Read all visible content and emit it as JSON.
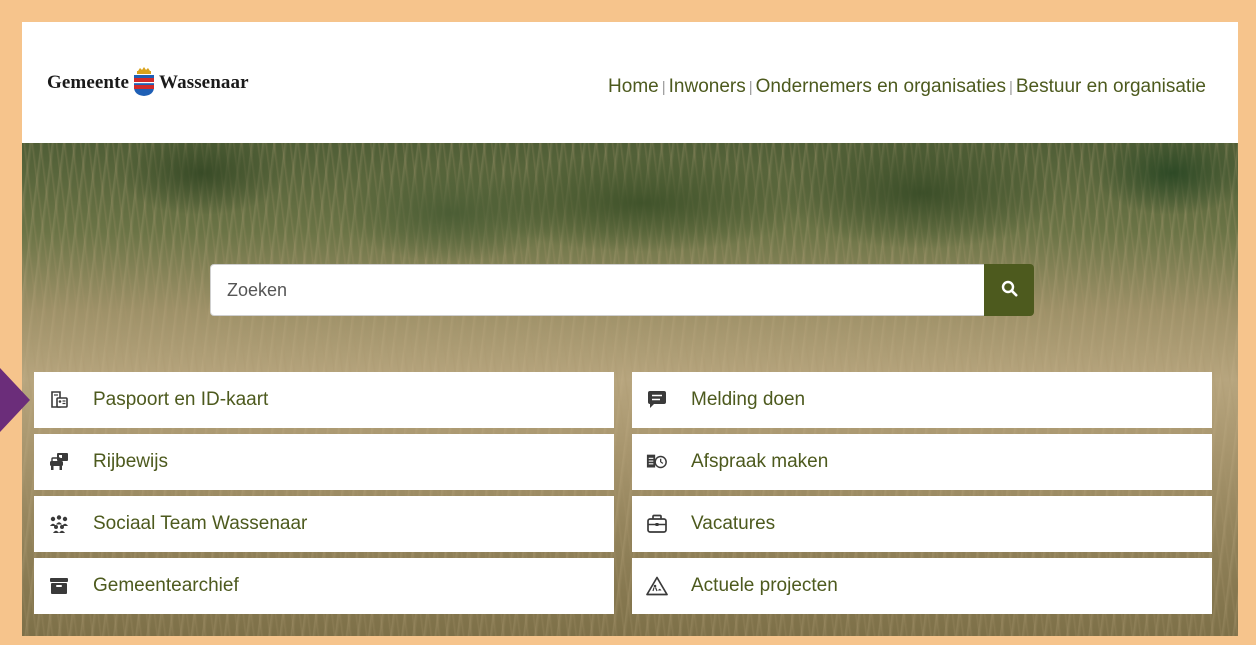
{
  "header": {
    "logo_text_left": "Gemeente",
    "logo_text_right": "Wassenaar",
    "nav": [
      {
        "label": "Home"
      },
      {
        "label": "Inwoners"
      },
      {
        "label": "Ondernemers en organisaties"
      },
      {
        "label": "Bestuur en organisatie"
      }
    ],
    "separator": "|"
  },
  "search": {
    "placeholder": "Zoeken",
    "button_icon": "search-icon"
  },
  "tiles": {
    "left": [
      {
        "label": "Paspoort en ID-kaart",
        "icon": "passport-id-icon"
      },
      {
        "label": "Rijbewijs",
        "icon": "driving-license-icon"
      },
      {
        "label": "Sociaal Team Wassenaar",
        "icon": "social-team-icon"
      },
      {
        "label": "Gemeentearchief",
        "icon": "archive-box-icon"
      }
    ],
    "right": [
      {
        "label": "Melding doen",
        "icon": "message-icon"
      },
      {
        "label": "Afspraak maken",
        "icon": "appointment-icon"
      },
      {
        "label": "Vacatures",
        "icon": "briefcase-icon"
      },
      {
        "label": "Actuele projecten",
        "icon": "warning-road-icon"
      }
    ]
  },
  "colors": {
    "frame": "#f6c48c",
    "accent": "#4d5a1e",
    "arrow": "#6b2d7a"
  }
}
